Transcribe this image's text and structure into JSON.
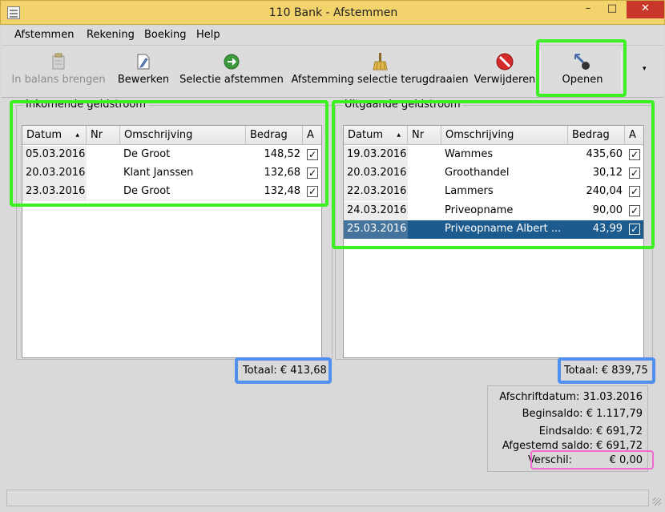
{
  "window": {
    "title": "110 Bank - Afstemmen",
    "minimize": "–",
    "maximize": "□",
    "close": "✕"
  },
  "menubar": [
    {
      "label": "Afstemmen"
    },
    {
      "label": "Rekening"
    },
    {
      "label": "Boeking"
    },
    {
      "label": "Help"
    }
  ],
  "toolbar": {
    "in_balans": {
      "label": "In balans brengen",
      "icon": "balance-icon"
    },
    "bewerken": {
      "label": "Bewerken",
      "icon": "edit-icon"
    },
    "selectie_afstemmen": {
      "label": "Selectie afstemmen",
      "icon": "arrow-right-icon"
    },
    "terugdraaien": {
      "label": "Afstemming selectie terugdraaien",
      "icon": "broom-icon"
    },
    "verwijderen": {
      "label": "Verwijderen",
      "icon": "stop-icon"
    },
    "openen": {
      "label": "Openen",
      "icon": "open-icon"
    },
    "overflow": "▾"
  },
  "columns": {
    "datum": "Datum",
    "nr": "Nr",
    "omschrijving": "Omschrijving",
    "bedrag": "Bedrag",
    "a": "A",
    "sort": "▲"
  },
  "incoming": {
    "title": "Inkomende geldstroom",
    "rows": [
      {
        "datum": "05.03.2016",
        "nr": "",
        "omschrijving": "De Groot",
        "bedrag": "148,52",
        "checked": "✓"
      },
      {
        "datum": "20.03.2016",
        "nr": "",
        "omschrijving": "Klant Janssen",
        "bedrag": "132,68",
        "checked": "✓"
      },
      {
        "datum": "23.03.2016",
        "nr": "",
        "omschrijving": "De Groot",
        "bedrag": "132,48",
        "checked": "✓"
      }
    ],
    "total": "Totaal: € 413,68"
  },
  "outgoing": {
    "title": "Uitgaande geldstroom",
    "rows": [
      {
        "datum": "19.03.2016",
        "nr": "",
        "omschrijving": "Wammes",
        "bedrag": "435,60",
        "checked": "✓"
      },
      {
        "datum": "20.03.2016",
        "nr": "",
        "omschrijving": "Groothandel",
        "bedrag": "30,12",
        "checked": "✓"
      },
      {
        "datum": "22.03.2016",
        "nr": "",
        "omschrijving": "Lammers",
        "bedrag": "240,04",
        "checked": "✓"
      },
      {
        "datum": "24.03.2016",
        "nr": "",
        "omschrijving": "Priveopname",
        "bedrag": "90,00",
        "checked": "✓"
      },
      {
        "datum": "25.03.2016",
        "nr": "",
        "omschrijving": "Priveopname Albert ...",
        "bedrag": "43,99",
        "checked": "✓"
      }
    ],
    "total": "Totaal: € 839,75"
  },
  "summary": {
    "afschriftdatum": "Afschriftdatum: 31.03.2016",
    "beginsaldo": "Beginsaldo:  € 1.117,79",
    "eindsaldo": "Eindsaldo:  € 691,72",
    "afgestemd": "Afgestemd saldo:  € 691,72",
    "verschil_label": "Verschil:",
    "verschil_value": "€ 0,00"
  },
  "colors": {
    "highlight_green": "#3cf023",
    "highlight_blue": "#4f8ff0",
    "highlight_pink": "#f06ad2",
    "selection": "#1d5b8f",
    "titlebar": "#f2d36c",
    "close": "#c7382b"
  }
}
